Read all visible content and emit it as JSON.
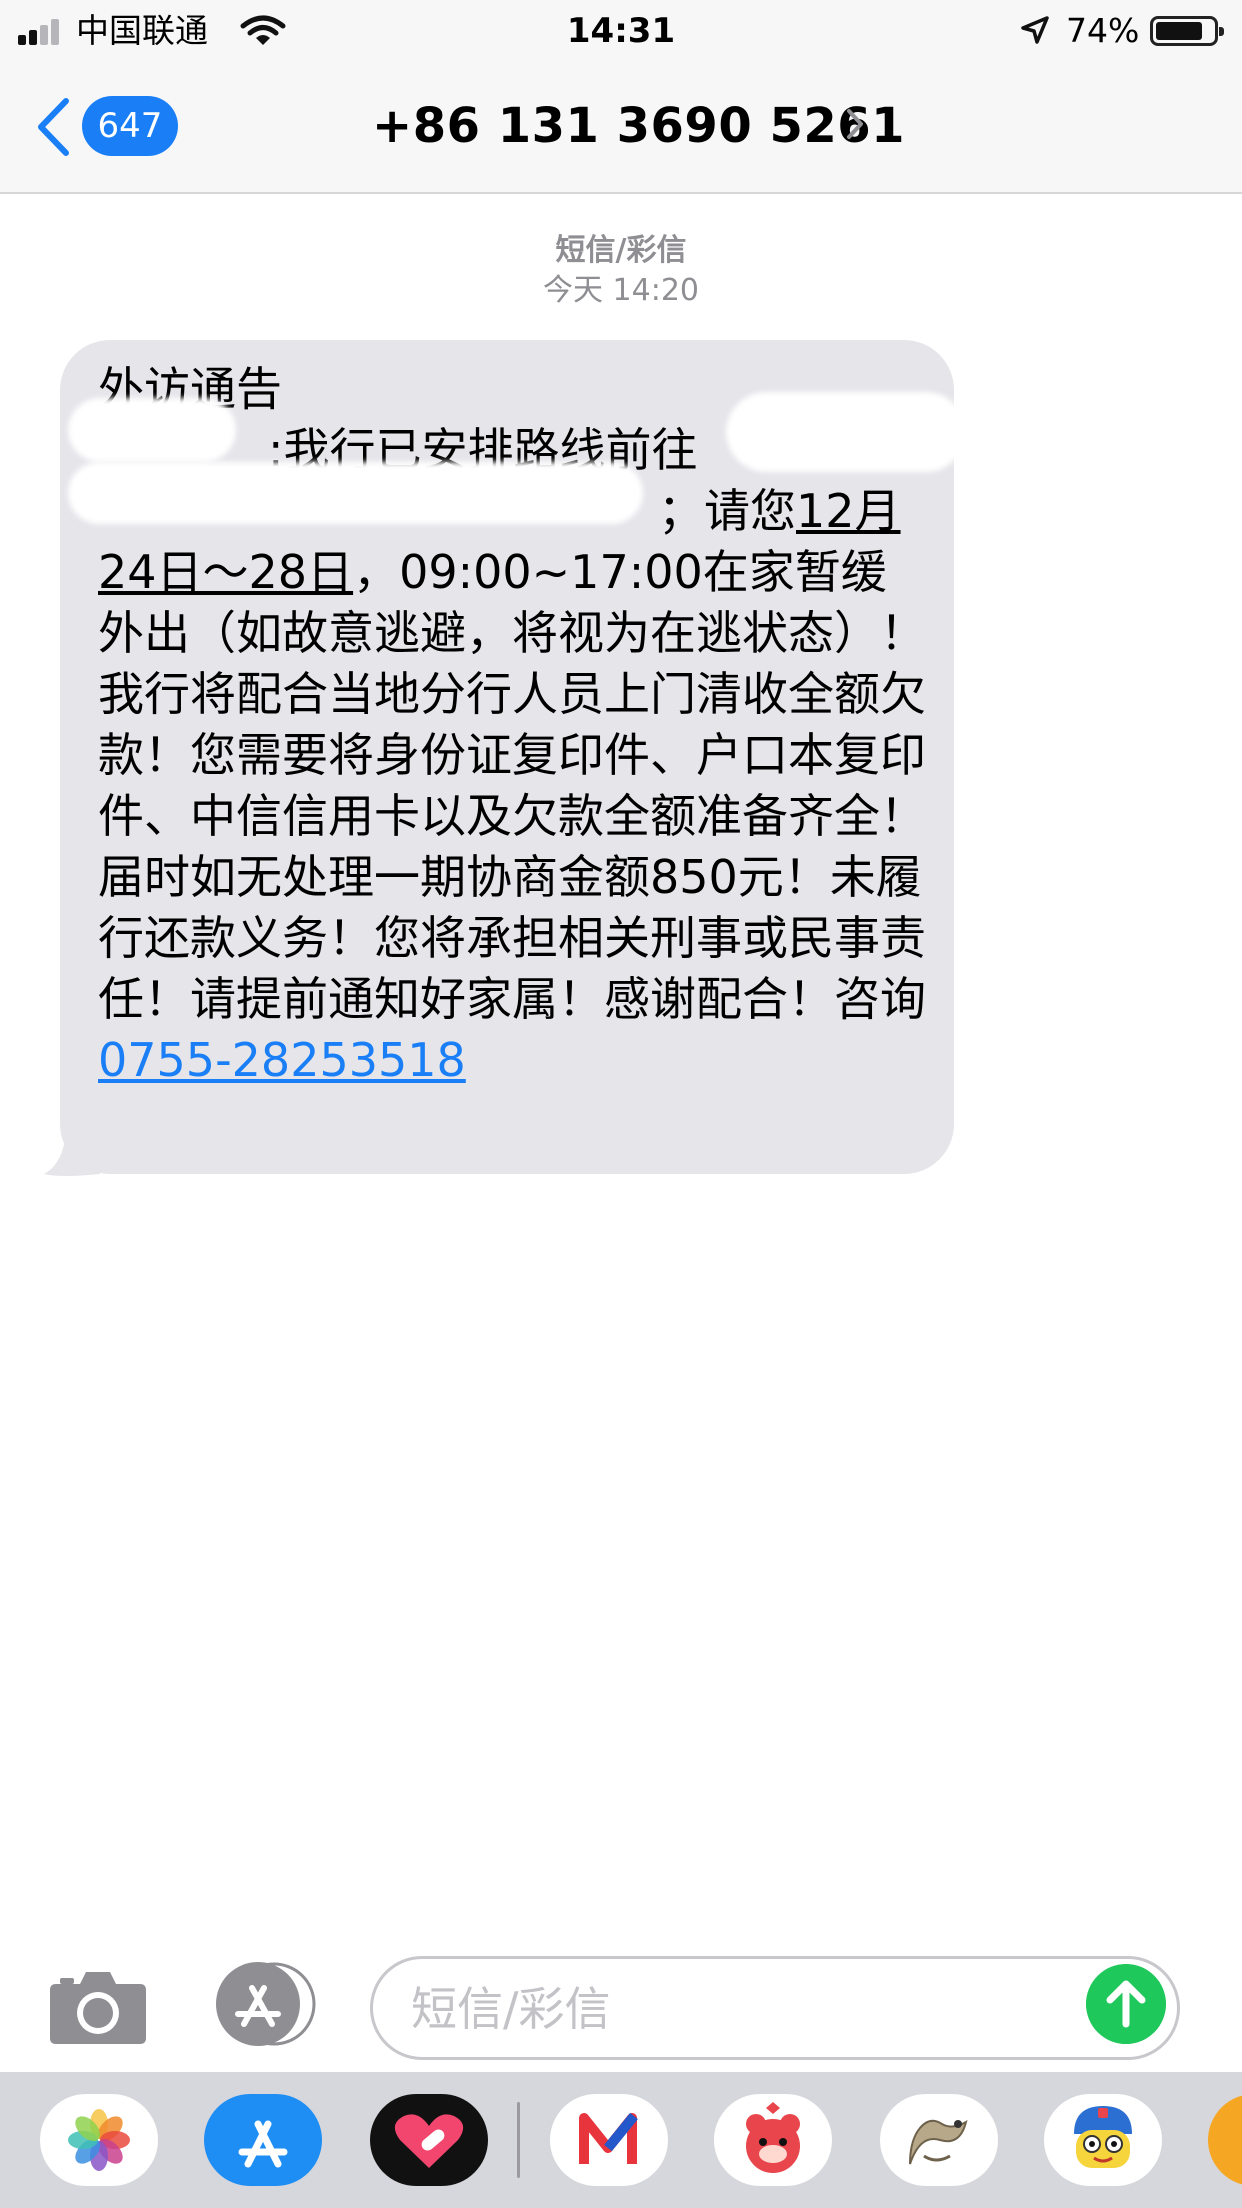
{
  "status_bar": {
    "carrier": "中国联通",
    "time": "14:31",
    "battery_percent": "74%",
    "battery_level": 0.74,
    "signal_bars": 2
  },
  "nav": {
    "unread_count": "647",
    "contact": "+86 131 3690 5261"
  },
  "conversation": {
    "message_type": "短信/彩信",
    "timestamp": "今天 14:20",
    "message": {
      "title": "外访通告",
      "part1": ":我行已安排路线前往",
      "part2": "；请您",
      "date_range": "12月24日～28日",
      "part3": "，09:00~17:00在家暂缓外出（如故意逃避，将视为在逃状态）！我行将配合当地分行人员上门清收全额欠款！您需要将身份证复印件、户口本复印件、中信信用卡以及欠款全额准备齐全！届时如无处理一期协商金额850元！未履行还款义务！您将承担相关刑事或民事责任！请提前通知好家属！感谢配合！咨询",
      "phone_link": "0755-28253518"
    }
  },
  "input_bar": {
    "placeholder": "短信/彩信"
  },
  "colors": {
    "accent": "#1a7ff6",
    "bubble": "#e5e5ea",
    "send": "#1fc85a",
    "meta": "#8e8e93"
  },
  "app_strip": {
    "apps": [
      "photos-icon",
      "app-store-icon",
      "heart-app-icon",
      "m-app-icon",
      "bear-app-icon",
      "dragon-app-icon",
      "character-app-icon",
      "partial-app-icon"
    ]
  }
}
